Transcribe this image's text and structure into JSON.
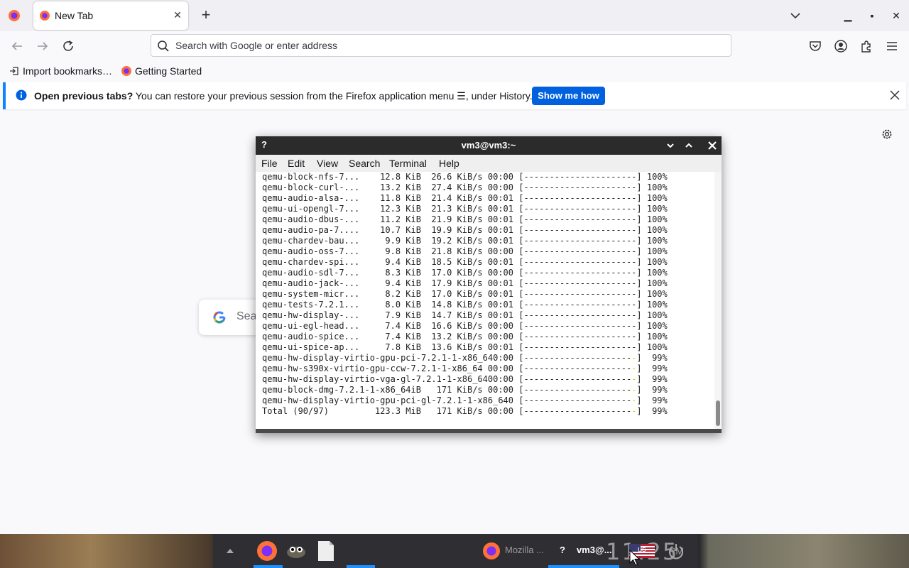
{
  "browser": {
    "tab": {
      "title": "New Tab"
    },
    "urlbar": {
      "placeholder": "Search with Google or enter address"
    },
    "bookmarks": [
      "Import bookmarks…",
      "Getting Started"
    ],
    "notification": {
      "bold": "Open previous tabs?",
      "text": " You can restore your previous session from the Firefox application menu ☰, under History.",
      "button": "Show me how"
    },
    "google_search_placeholder": "Sea"
  },
  "terminal": {
    "title": "vm3@vm3:~",
    "help_glyph": "?",
    "menu": [
      "File",
      "Edit",
      "View",
      "Search",
      "Terminal",
      "Help"
    ],
    "lines": [
      {
        "pkg": "qemu-block-nfs-7...",
        "size": "12.8 KiB",
        "rate": "26.6 KiB/s",
        "time": "00:00",
        "bar": "[----------------------]",
        "pct": "100%"
      },
      {
        "pkg": "qemu-block-curl-...",
        "size": "13.2 KiB",
        "rate": "27.4 KiB/s",
        "time": "00:00",
        "bar": "[----------------------]",
        "pct": "100%"
      },
      {
        "pkg": "qemu-audio-alsa-...",
        "size": "11.8 KiB",
        "rate": "21.4 KiB/s",
        "time": "00:01",
        "bar": "[----------------------]",
        "pct": "100%"
      },
      {
        "pkg": "qemu-ui-opengl-7...",
        "size": "12.3 KiB",
        "rate": "21.3 KiB/s",
        "time": "00:01",
        "bar": "[----------------------]",
        "pct": "100%"
      },
      {
        "pkg": "qemu-audio-dbus-...",
        "size": "11.2 KiB",
        "rate": "21.9 KiB/s",
        "time": "00:01",
        "bar": "[----------------------]",
        "pct": "100%"
      },
      {
        "pkg": "qemu-audio-pa-7....",
        "size": "10.7 KiB",
        "rate": "19.9 KiB/s",
        "time": "00:01",
        "bar": "[----------------------]",
        "pct": "100%"
      },
      {
        "pkg": "qemu-chardev-bau...",
        "size": "9.9 KiB",
        "rate": "19.2 KiB/s",
        "time": "00:01",
        "bar": "[----------------------]",
        "pct": "100%"
      },
      {
        "pkg": "qemu-audio-oss-7...",
        "size": "9.8 KiB",
        "rate": "21.8 KiB/s",
        "time": "00:00",
        "bar": "[----------------------]",
        "pct": "100%"
      },
      {
        "pkg": "qemu-chardev-spi...",
        "size": "9.4 KiB",
        "rate": "18.5 KiB/s",
        "time": "00:01",
        "bar": "[----------------------]",
        "pct": "100%"
      },
      {
        "pkg": "qemu-audio-sdl-7...",
        "size": "8.3 KiB",
        "rate": "17.0 KiB/s",
        "time": "00:00",
        "bar": "[----------------------]",
        "pct": "100%"
      },
      {
        "pkg": "qemu-audio-jack-...",
        "size": "9.4 KiB",
        "rate": "17.9 KiB/s",
        "time": "00:01",
        "bar": "[----------------------]",
        "pct": "100%"
      },
      {
        "pkg": "qemu-system-micr...",
        "size": "8.2 KiB",
        "rate": "17.0 KiB/s",
        "time": "00:01",
        "bar": "[----------------------]",
        "pct": "100%"
      },
      {
        "pkg": "qemu-tests-7.2.1...",
        "size": "8.0 KiB",
        "rate": "14.8 KiB/s",
        "time": "00:01",
        "bar": "[----------------------]",
        "pct": "100%"
      },
      {
        "pkg": "qemu-hw-display-...",
        "size": "7.9 KiB",
        "rate": "14.7 KiB/s",
        "time": "00:01",
        "bar": "[----------------------]",
        "pct": "100%"
      },
      {
        "pkg": "qemu-ui-egl-head...",
        "size": "7.4 KiB",
        "rate": "16.6 KiB/s",
        "time": "00:00",
        "bar": "[----------------------]",
        "pct": "100%"
      },
      {
        "pkg": "qemu-audio-spice...",
        "size": "7.4 KiB",
        "rate": "13.2 KiB/s",
        "time": "00:00",
        "bar": "[----------------------]",
        "pct": "100%"
      },
      {
        "pkg": "qemu-ui-spice-ap...",
        "size": "7.8 KiB",
        "rate": "13.6 KiB/s",
        "time": "00:01",
        "bar": "[----------------------]",
        "pct": "100%"
      }
    ],
    "raw_lines": [
      {
        "text": "qemu-hw-display-virtio-gpu-pci-7.2.1-1-x86_640:00 [---------------------",
        "tail": "-",
        "end": "]  99%"
      },
      {
        "text": "qemu-hw-s390x-virtio-gpu-ccw-7.2.1-1-x86_64 00:00 [---------------------",
        "tail": "-",
        "end": "]  99%"
      },
      {
        "text": "qemu-hw-display-virtio-vga-gl-7.2.1-1-x86_6400:00 [---------------------",
        "tail": "-",
        "end": "]  99%"
      },
      {
        "text": "qemu-block-dmg-7.2.1-1-x86_64iB   171 KiB/s 00:00 [---------------------",
        "tail": "-",
        "end": "]  99%"
      },
      {
        "text": "qemu-hw-display-virtio-gpu-pci-gl-7.2.1-1-x86_640 [---------------------",
        "tail": "-",
        "end": "]  99%"
      },
      {
        "text": "Total (90/97)         123.3 MiB   171 KiB/s 00:00 [---------------------",
        "tail": "-",
        "end": "]  99%"
      }
    ],
    "progress_color": "#e0d000"
  },
  "taskbar": {
    "clock": "11:25",
    "clock_suffix": "PM",
    "firefox_task": "Mozilla ...",
    "terminal_task": "vm3@...",
    "terminal_glyph": "?",
    "keyboard_layout": "us"
  },
  "colors": {
    "accent": "#0061e0",
    "notification_border": "#0a84ff",
    "terminal_titlebar": "#2b2b2b",
    "taskbar": "#2f2f33",
    "task_indicator": "#1e90ff"
  },
  "icons": {
    "tab_strip": [
      "firefox-menu-icon",
      "firefox-tab-icon",
      "close-icon",
      "plus-icon",
      "chevron-down-icon",
      "minimize-icon",
      "maximize-icon",
      "close-window-icon"
    ],
    "nav": [
      "back-arrow-icon",
      "forward-arrow-icon",
      "reload-icon",
      "search-icon",
      "pocket-icon",
      "account-icon",
      "extensions-icon",
      "hamburger-menu-icon"
    ],
    "bookmarks": [
      "import-icon",
      "firefox-icon"
    ],
    "content": [
      "info-icon",
      "close-icon",
      "gear-icon",
      "google-g-icon"
    ],
    "terminal": [
      "chevron-down-icon",
      "chevron-up-icon",
      "close-icon"
    ],
    "taskbar": [
      "chevron-up-icon",
      "firefox-icon",
      "gimp-icon",
      "document-icon",
      "firefox-icon",
      "us-flag-icon",
      "power-icon"
    ]
  }
}
